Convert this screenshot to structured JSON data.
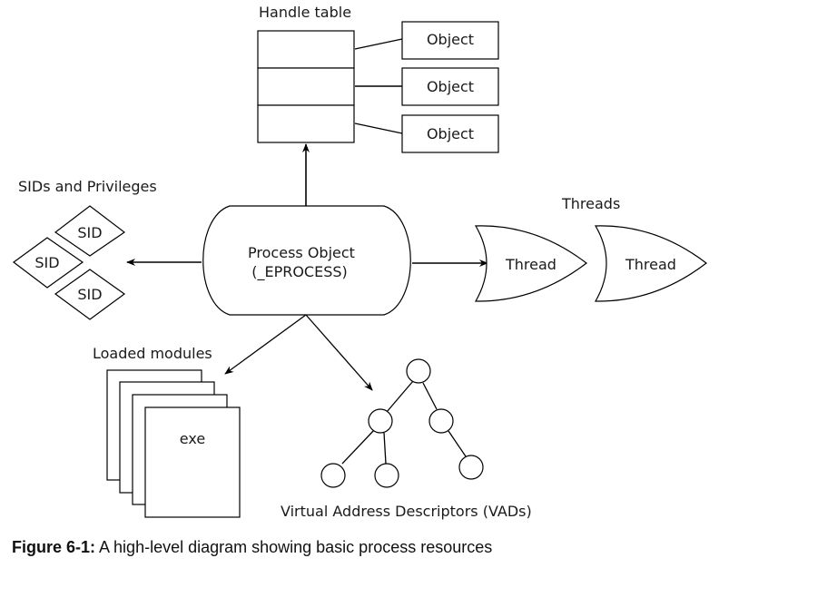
{
  "diagram": {
    "central": {
      "line1": "Process Object",
      "line2": "(_EPROCESS)"
    },
    "handle_table": {
      "title": "Handle table",
      "rows": 3,
      "objects": [
        "Object",
        "Object",
        "Object"
      ]
    },
    "sids": {
      "title": "SIDs and Privileges",
      "items": [
        "SID",
        "SID",
        "SID"
      ]
    },
    "threads": {
      "title": "Threads",
      "items": [
        "Thread",
        "Thread"
      ]
    },
    "modules": {
      "title": "Loaded modules",
      "front_label": "exe",
      "page_count": 4
    },
    "vads": {
      "title": "Virtual Address Descriptors (VADs)",
      "node_count": 6
    },
    "colors": {
      "stroke": "#000000",
      "fill": "#ffffff",
      "text": "#1a1a1a"
    }
  },
  "caption": {
    "figure_label": "Figure 6-1:",
    "text": "A high-level diagram showing basic process resources"
  }
}
